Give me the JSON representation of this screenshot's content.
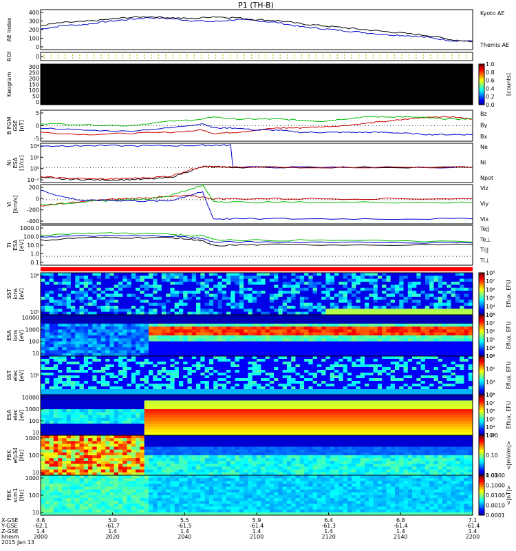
{
  "title": "P1  (TH-B)",
  "chart_data": [
    {
      "type": "line",
      "id": "ae",
      "ylabel": "AE Index",
      "yticks": [
        "400",
        "300",
        "200",
        "100",
        "0"
      ],
      "ylim": [
        0,
        400
      ],
      "legend": [
        {
          "name": "Kyoto AE",
          "color": "#0000cc"
        },
        {
          "name": "Themis AE",
          "color": "#000000"
        }
      ],
      "series": [
        {
          "name": "Kyoto AE",
          "color": "#0000cc",
          "x": [
            0,
            10,
            20,
            30,
            40,
            50,
            60,
            70,
            80,
            90,
            100,
            110,
            120,
            130,
            140,
            150,
            160,
            170,
            180,
            190,
            200
          ],
          "values": [
            205,
            240,
            250,
            280,
            300,
            320,
            310,
            290,
            280,
            300,
            290,
            270,
            230,
            210,
            190,
            170,
            150,
            140,
            120,
            90,
            85
          ]
        },
        {
          "name": "Themis AE",
          "color": "#000000",
          "x": [
            0,
            10,
            20,
            30,
            40,
            50,
            60,
            70,
            80,
            90,
            100,
            110,
            120,
            130,
            140,
            150,
            160,
            170,
            180,
            190,
            200
          ],
          "values": [
            240,
            270,
            280,
            300,
            320,
            330,
            320,
            310,
            330,
            320,
            300,
            290,
            260,
            240,
            220,
            200,
            180,
            160,
            140,
            100,
            80
          ]
        }
      ]
    },
    {
      "type": "line",
      "id": "roi",
      "ylabel": "ROI",
      "yticks": [
        "0"
      ]
    },
    {
      "type": "heatmap",
      "id": "keogram",
      "ylabel": "Keogram",
      "yticks": [
        "300",
        "250",
        "200",
        "150",
        "100",
        "50",
        "0"
      ],
      "ylim": [
        0,
        300
      ],
      "colorbar": {
        "label": "[counts]",
        "ticks": [
          "1.0",
          "0.8",
          "0.6",
          "0.4",
          "0.2",
          "0.0"
        ]
      }
    },
    {
      "type": "line",
      "id": "bfgm",
      "ylabel": "B FGM",
      "ylabel2": "GSE",
      "ylabel3": "[nT]",
      "yticks": [
        "5",
        "0",
        "-5"
      ],
      "ylim": [
        -7,
        7
      ],
      "legend": [
        {
          "name": "Bz",
          "color": "#cc0000"
        },
        {
          "name": "By",
          "color": "#00bb00"
        },
        {
          "name": "Bx",
          "color": "#0000cc"
        }
      ],
      "series": [
        {
          "name": "Bz",
          "color": "#cc0000",
          "x": [
            0,
            20,
            40,
            60,
            75,
            80,
            90,
            100,
            110,
            120,
            130,
            140,
            150,
            160,
            170,
            180,
            190,
            200
          ],
          "values": [
            -3,
            -4,
            -3.5,
            -3,
            -2,
            -3.5,
            -3,
            -2,
            -1,
            -1,
            -0.5,
            0,
            1,
            2,
            3,
            4,
            4,
            3
          ]
        },
        {
          "name": "By",
          "color": "#00bb00",
          "x": [
            0,
            20,
            40,
            60,
            75,
            80,
            90,
            100,
            110,
            120,
            130,
            140,
            150,
            160,
            170,
            180,
            190,
            200
          ],
          "values": [
            1,
            0.5,
            0,
            2,
            3,
            4,
            3,
            3,
            3,
            2.5,
            2,
            3,
            4,
            4,
            4,
            3.5,
            3,
            3
          ]
        },
        {
          "name": "Bx",
          "color": "#0000cc",
          "x": [
            0,
            20,
            40,
            60,
            75,
            80,
            90,
            100,
            110,
            120,
            130,
            140,
            150,
            160,
            170,
            180,
            190,
            200
          ],
          "values": [
            -1,
            -2,
            -2.5,
            -1,
            1,
            -1,
            -1,
            -2,
            -2,
            -3,
            -3,
            -3,
            -3,
            -3,
            -3.5,
            -4,
            -4,
            -4
          ]
        }
      ]
    },
    {
      "type": "line",
      "id": "density",
      "ylabel": "Ni",
      "ylabel2": "ESA",
      "ylabel3": "[1/cc]",
      "yticks": [
        "10⁴",
        "10²",
        "10⁰",
        "10⁻²"
      ],
      "log": true,
      "ylim": [
        -3,
        5
      ],
      "legend": [
        {
          "name": "Ne",
          "color": "#cc0000"
        },
        {
          "name": "Ni",
          "color": "#000000"
        },
        {
          "name": "Npot",
          "color": "#0000cc"
        }
      ],
      "series": [
        {
          "name": "Npot",
          "color": "#0000cc",
          "x": [
            0,
            10,
            20,
            40,
            60,
            74,
            80,
            88,
            89,
            120,
            160,
            200
          ],
          "values": [
            4.4,
            4.5,
            4.5,
            4.5,
            4.5,
            4.6,
            4.6,
            4.6,
            0.1,
            0.1,
            0.1,
            0.1
          ]
        },
        {
          "name": "Ni",
          "color": "#000000",
          "x": [
            0,
            10,
            20,
            30,
            40,
            50,
            60,
            70,
            75,
            80,
            90,
            120,
            160,
            200
          ],
          "values": [
            -2,
            -2.3,
            -2.4,
            -2.5,
            -2.4,
            -2.3,
            -2,
            -0.5,
            0.2,
            0.2,
            0.1,
            0.1,
            0.1,
            0.1
          ]
        },
        {
          "name": "Ne",
          "color": "#cc0000",
          "x": [
            0,
            10,
            20,
            30,
            40,
            50,
            60,
            70,
            75,
            80,
            90,
            120,
            160,
            200
          ],
          "values": [
            -1.8,
            -2.1,
            -2.2,
            -2.3,
            -2.2,
            -2,
            -1.7,
            -0.3,
            0.3,
            0.2,
            0.1,
            0.1,
            0.1,
            0.1
          ]
        }
      ]
    },
    {
      "type": "line",
      "id": "velocity",
      "ylabel": "Vi",
      "ylabel2": "[km/s]",
      "yticks": [
        "200",
        "0",
        "-200",
        "-400"
      ],
      "ylim": [
        -480,
        300
      ],
      "legend": [
        {
          "name": "Viz",
          "color": "#cc0000"
        },
        {
          "name": "Viy",
          "color": "#00bb00"
        },
        {
          "name": "Vix",
          "color": "#0000cc"
        }
      ],
      "series": [
        {
          "name": "Viz",
          "color": "#cc0000",
          "x": [
            0,
            10,
            20,
            30,
            40,
            50,
            60,
            70,
            80,
            90,
            120,
            160,
            200
          ],
          "values": [
            -120,
            -80,
            -40,
            0,
            20,
            40,
            60,
            80,
            20,
            20,
            20,
            20,
            20
          ]
        },
        {
          "name": "Viy",
          "color": "#00bb00",
          "x": [
            0,
            10,
            20,
            30,
            40,
            50,
            60,
            70,
            75,
            80,
            90,
            120,
            160,
            200
          ],
          "values": [
            -100,
            -80,
            -40,
            -20,
            0,
            20,
            80,
            220,
            290,
            -30,
            -50,
            -50,
            -50,
            -60
          ]
        },
        {
          "name": "Vix",
          "color": "#0000cc",
          "x": [
            0,
            10,
            20,
            30,
            40,
            50,
            60,
            70,
            75,
            80,
            90,
            120,
            160,
            200
          ],
          "values": [
            190,
            60,
            -20,
            -10,
            -20,
            -30,
            -20,
            100,
            150,
            -380,
            -380,
            -380,
            -380,
            -380
          ]
        }
      ]
    },
    {
      "type": "line",
      "id": "temperature",
      "ylabel": "Ti",
      "ylabel2": "ESA",
      "ylabel3": "[eV]",
      "yticks": [
        "1000.0",
        "100.0",
        "10.0",
        "1.0",
        "0.1"
      ],
      "log": true,
      "ylim": [
        -1,
        3.5
      ],
      "legend": [
        {
          "name": "Te||",
          "color": "#000000"
        },
        {
          "name": "Te⊥",
          "color": "#cc0000"
        },
        {
          "name": "Ti||",
          "color": "#00bb00"
        },
        {
          "name": "Ti⊥",
          "color": "#0000cc"
        }
      ],
      "series": [
        {
          "name": "Ti||",
          "color": "#00bb00",
          "x": [
            0,
            20,
            40,
            60,
            70,
            75,
            80,
            100,
            140,
            200
          ],
          "values": [
            2.4,
            2.6,
            2.6,
            2.5,
            2.3,
            2.4,
            1.9,
            1.8,
            1.8,
            1.6
          ]
        },
        {
          "name": "Ti⊥",
          "color": "#0000cc",
          "x": [
            0,
            20,
            40,
            60,
            70,
            75,
            80,
            100,
            140,
            200
          ],
          "values": [
            2.2,
            2.3,
            2.3,
            2.3,
            2.1,
            2.0,
            1.6,
            1.6,
            1.6,
            1.5
          ]
        },
        {
          "name": "Te||",
          "color": "#000000",
          "x": [
            0,
            20,
            40,
            60,
            70,
            75,
            80,
            100,
            140,
            200
          ],
          "values": [
            1.8,
            2.1,
            2.1,
            2.1,
            1.9,
            1.7,
            1.2,
            1.3,
            1.3,
            1.3
          ]
        }
      ]
    },
    {
      "type": "heatmap",
      "id": "sst_ion",
      "ylabel": "SST",
      "ylabel2": "ions",
      "ylabel3": "[eV]",
      "yticks": [
        "10⁶",
        "10⁵"
      ],
      "colorbar": {
        "label": "Eflux, EFU",
        "ticks": [
          "10⁸",
          "10⁷",
          "10⁶",
          "10⁵",
          "10⁴",
          "10³"
        ]
      }
    },
    {
      "type": "heatmap",
      "id": "esa_ion",
      "ylabel": "ESA",
      "ylabel2": "ions",
      "ylabel3": "[eV]",
      "yticks": [
        "10000",
        "1000",
        "100",
        "10"
      ],
      "colorbar": {
        "label": "Eflux, EFU",
        "ticks": [
          "10⁸",
          "10⁷",
          "10⁶",
          "10⁵",
          "10⁴",
          "10³"
        ]
      }
    },
    {
      "type": "heatmap",
      "id": "sst_elec",
      "ylabel": "SST",
      "ylabel2": "elec",
      "ylabel3": "[eV]",
      "yticks": [
        "10⁵"
      ],
      "colorbar": {
        "label": "Eflux, EFU",
        "ticks": [
          "10⁶",
          "10⁵",
          "10⁴",
          "10³"
        ]
      }
    },
    {
      "type": "heatmap",
      "id": "esa_elec",
      "ylabel": "ESA",
      "ylabel2": "elec",
      "ylabel3": "[eV]",
      "yticks": [
        "10000",
        "1000",
        "100",
        "10"
      ],
      "colorbar": {
        "label": "Eflux, EFU",
        "ticks": [
          "10⁸",
          "10⁷",
          "10⁶",
          "10⁵",
          "10⁴",
          "10³"
        ]
      }
    },
    {
      "type": "heatmap",
      "id": "fbk_e",
      "ylabel": "FBK",
      "ylabel2": "efp34",
      "ylabel3": "[Hz]",
      "yticks": [
        "1000",
        "100",
        "10"
      ],
      "colorbar": {
        "label": "<|mV/m|>",
        "ticks": [
          "1.00",
          "0.10",
          "0.01"
        ]
      }
    },
    {
      "type": "heatmap",
      "id": "fbk_b",
      "ylabel": "FBK",
      "ylabel2": "scm1",
      "ylabel3": "[Hz]",
      "yticks": [
        "1000",
        "100",
        "10"
      ],
      "colorbar": {
        "label": "<|nT|>",
        "ticks": [
          "1.0000",
          "0.1000",
          "0.0100",
          "0.0010",
          "0.0001"
        ]
      }
    }
  ],
  "xaxis": {
    "row_labels": [
      "X-GSE",
      "Y-GSE",
      "Z-GSE",
      "hhmm",
      "2015 Jan 13"
    ],
    "ticks": [
      {
        "x": "4.8",
        "y": "-62.1",
        "z": "1.4",
        "t": "2000"
      },
      {
        "x": "5.0",
        "y": "-61.7",
        "z": "1.4",
        "t": "2020"
      },
      {
        "x": "5.5",
        "y": "-61.5",
        "z": "1.4",
        "t": "2040"
      },
      {
        "x": "5.9",
        "y": "-61.4",
        "z": "1.4",
        "t": "2100"
      },
      {
        "x": "6.4",
        "y": "-61.3",
        "z": "1.4",
        "t": "2120"
      },
      {
        "x": "6.8",
        "y": "-61.4",
        "z": "1.4",
        "t": "2140"
      },
      {
        "x": "7.1",
        "y": "-61.4",
        "z": "1.4",
        "t": "2200"
      }
    ]
  },
  "colors": {
    "red": "#cc0000",
    "green": "#00bb00",
    "blue": "#0000cc",
    "black": "#000000"
  }
}
